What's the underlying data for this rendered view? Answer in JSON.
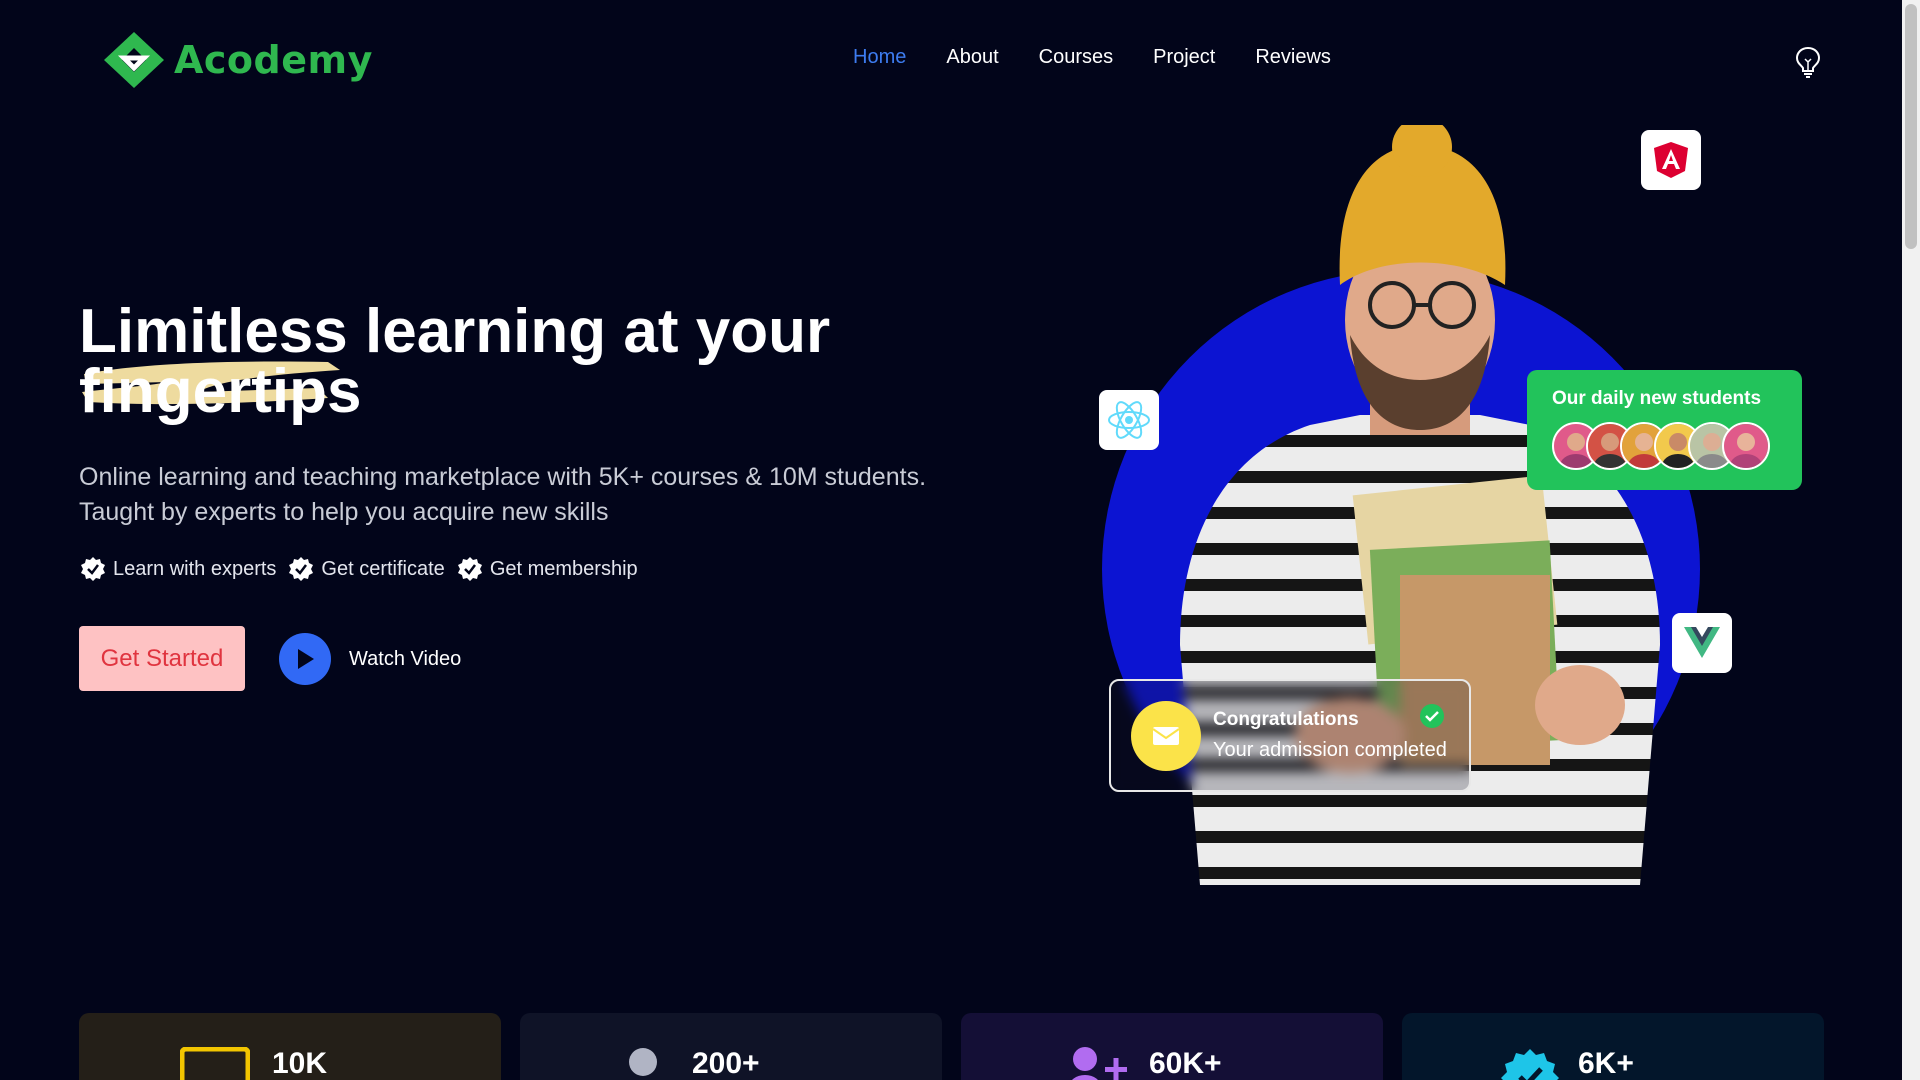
{
  "header": {
    "logo_text": "Acodemy",
    "nav": [
      "Home",
      "About",
      "Courses",
      "Project",
      "Reviews"
    ],
    "active_nav": "Home"
  },
  "hero": {
    "title": "Limitless learning at your fingertips",
    "subtitle_line1": "Online learning and teaching marketplace with 5K+ courses & 10M students.",
    "subtitle_line2": "Taught by experts to help you acquire new skills",
    "features": [
      "Learn with experts",
      "Get certificate",
      "Get membership"
    ],
    "primary_button": "Get Started",
    "secondary_button": "Watch Video"
  },
  "students_card": {
    "title": "Our daily new students",
    "avatar_count": 6
  },
  "congrats_card": {
    "title": "Congratulations",
    "text": "Your admission completed"
  },
  "stats": [
    {
      "value": "10K",
      "icon": "tv-icon"
    },
    {
      "value": "200+",
      "icon": "dot-icon"
    },
    {
      "value": "60K+",
      "icon": "user-plus-icon"
    },
    {
      "value": "6K+",
      "icon": "verified-badge-icon"
    }
  ],
  "colors": {
    "background": "#02051a",
    "brand_green": "#2fb84f",
    "nav_active": "#3d7cf0",
    "hero_circle": "#0c14d2",
    "cta_bg": "#fec2c3",
    "cta_text": "#e0343f",
    "students_card": "#22c35b"
  }
}
